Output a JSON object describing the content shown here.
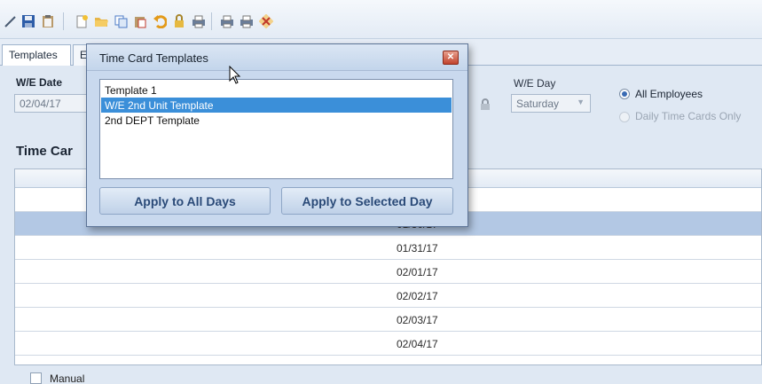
{
  "toolbar": {
    "icons": [
      "pencil-icon",
      "save-icon",
      "clipboard-icon",
      "new-doc-icon",
      "open-folder-icon",
      "copy-icon",
      "paste-icon",
      "undo-icon",
      "lock-icon",
      "print-icon",
      "print-preview-icon",
      "print-setup-icon",
      "cancel-icon"
    ]
  },
  "tabs": {
    "templates": "Templates",
    "second_partial": "E"
  },
  "form": {
    "we_date_label": "W/E Date",
    "we_date_value": "02/04/17",
    "we_day_label": "W/E Day",
    "we_day_value": "Saturday",
    "all_employees": "All Employees",
    "daily_only": "Daily Time Cards Only",
    "section_title_partial": "Time Car"
  },
  "grid": {
    "rows": [
      "",
      "",
      "01/30/17",
      "01/31/17",
      "02/01/17",
      "02/02/17",
      "02/03/17",
      "02/04/17"
    ],
    "selected_index": 2
  },
  "manual": {
    "label": "Manual"
  },
  "dialog": {
    "title": "Time Card Templates",
    "items": [
      "Template 1",
      "W/E 2nd Unit Template",
      "2nd DEPT Template"
    ],
    "selected_index": 1,
    "apply_all": "Apply to All Days",
    "apply_selected": "Apply to Selected Day"
  },
  "colors": {
    "selection": "#3b8fd9",
    "row_selected": "#b3c8e4",
    "background": "#dfe8f3"
  }
}
